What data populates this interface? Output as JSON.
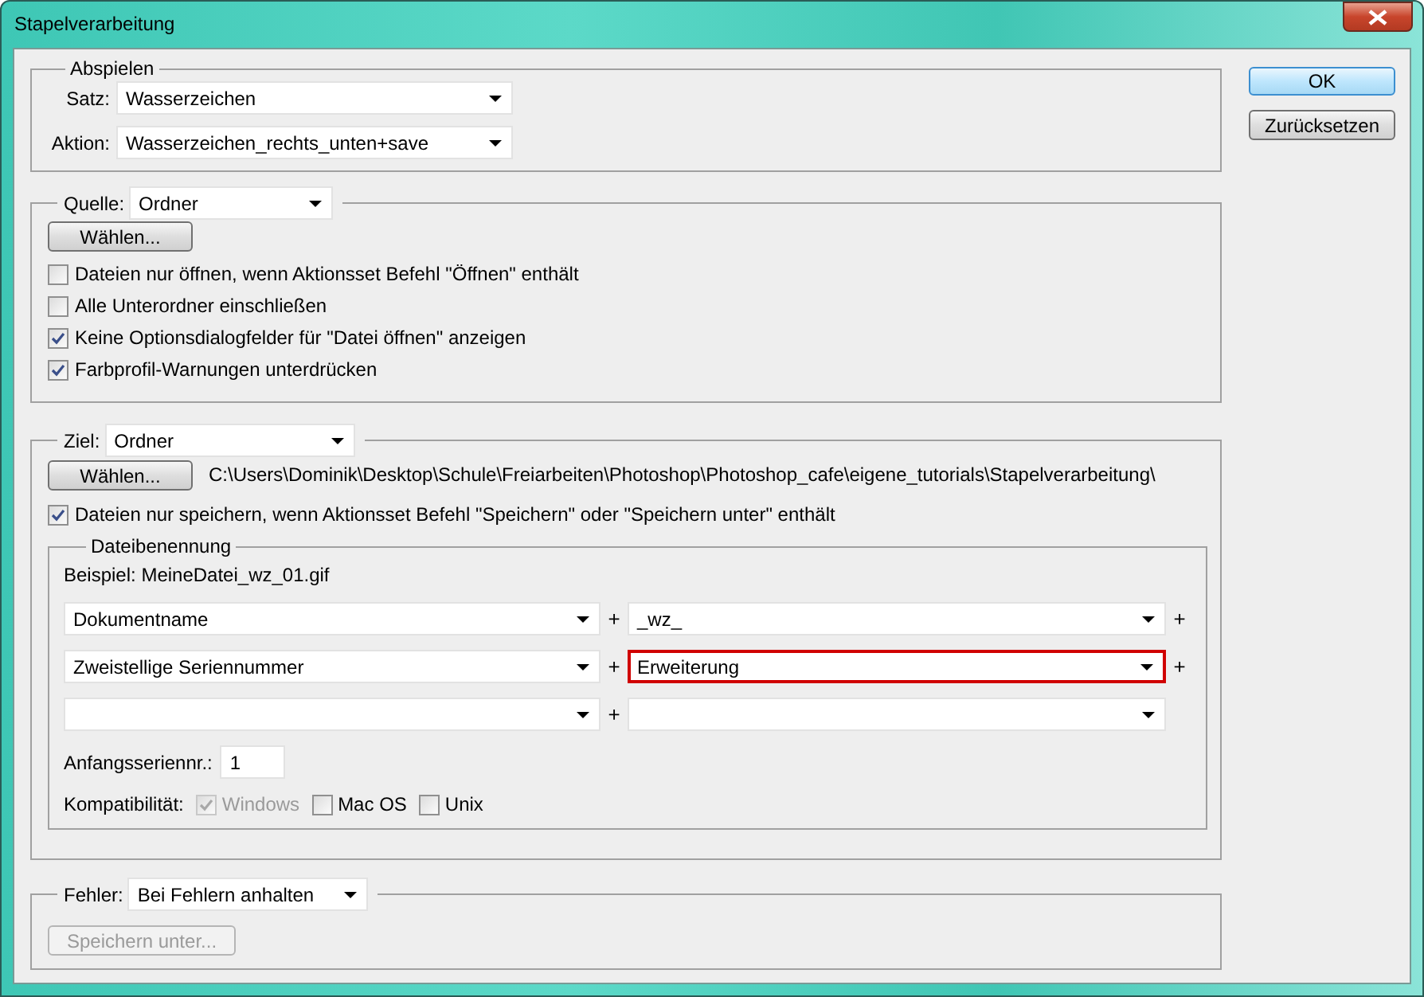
{
  "window": {
    "title": "Stapelverarbeitung"
  },
  "buttons": [
    {
      "label": "OK",
      "default": true
    },
    {
      "label": "Zurücksetzen",
      "default": false
    }
  ],
  "play": {
    "legend": "Abspielen",
    "fields": [
      {
        "label": "Satz:",
        "value": "Wasserzeichen"
      },
      {
        "label": "Aktion:",
        "value": "Wasserzeichen_rechts_unten+save"
      }
    ]
  },
  "source": {
    "label": "Quelle:",
    "value": "Ordner",
    "choose_button": "Wählen...",
    "options": [
      {
        "label": "Dateien nur öffnen, wenn Aktionsset Befehl \"Öffnen\" enthält",
        "checked": false
      },
      {
        "label": "Alle Unterordner einschließen",
        "checked": false
      },
      {
        "label": "Keine Optionsdialogfelder für \"Datei öffnen\" anzeigen",
        "checked": true
      },
      {
        "label": "Farbprofil-Warnungen unterdrücken",
        "checked": true
      }
    ]
  },
  "destination": {
    "label": "Ziel:",
    "value": "Ordner",
    "choose_button": "Wählen...",
    "path": "C:\\Users\\Dominik\\Desktop\\Schule\\Freiarbeiten\\Photoshop\\Photoshop_cafe\\eigene_tutorials\\Stapelverarbeitung\\",
    "options": [
      {
        "label": "Dateien nur speichern, wenn Aktionsset Befehl \"Speichern\" oder \"Speichern unter\" enthält",
        "checked": true
      }
    ],
    "naming": {
      "legend": "Dateibenennung",
      "example": "Beispiel: MeineDatei_wz_01.gif",
      "rows": [
        {
          "left": {
            "value": "Dokumentname",
            "highlighted": false
          },
          "middle": "+",
          "right": {
            "value": "_wz_",
            "highlighted": false
          },
          "end": "+"
        },
        {
          "left": {
            "value": "Zweistellige Seriennummer",
            "highlighted": false
          },
          "middle": "+",
          "right": {
            "value": "Erweiterung",
            "highlighted": true
          },
          "end": "+"
        },
        {
          "left": {
            "highlighted": false
          },
          "middle": "+",
          "right": {
            "highlighted": false
          }
        }
      ],
      "start_serial": {
        "label": "Anfangsseriennr.:",
        "value": "1"
      },
      "compatibility": {
        "label": "Kompatibilität:",
        "options": [
          {
            "label": "Windows",
            "checked": true,
            "disabled": true
          },
          {
            "label": "Mac OS",
            "checked": false,
            "disabled": false
          },
          {
            "label": "Unix",
            "checked": false,
            "disabled": false
          }
        ]
      }
    }
  },
  "errors": {
    "label": "Fehler:",
    "value": "Bei Fehlern anhalten",
    "save_as_button": {
      "label": "Speichern unter...",
      "disabled": true
    }
  }
}
